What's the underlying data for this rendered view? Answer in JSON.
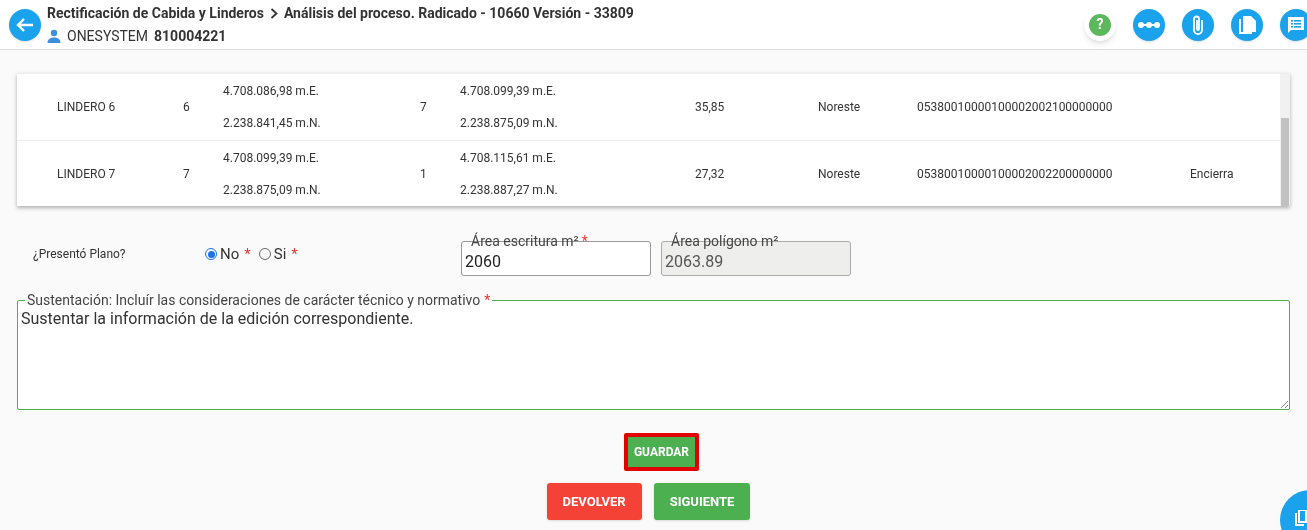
{
  "header": {
    "breadcrumb": [
      "Rectificación de Cabida y Linderos",
      "Análisis del proceso. Radicado - 10660 Versión - 33809"
    ],
    "user_label": "ONESYSTEM",
    "user_id": "810004221",
    "actions": [
      {
        "kind": "help",
        "label": "?"
      },
      {
        "kind": "flow"
      },
      {
        "kind": "attach"
      },
      {
        "kind": "docs"
      },
      {
        "kind": "notes"
      }
    ]
  },
  "table": {
    "rows": [
      {
        "name": "LINDERO 6",
        "from": "6",
        "from_east": "4.708.086,98 m.E.",
        "from_north": "2.238.841,45 m.N.",
        "to": "7",
        "to_east": "4.708.099,39 m.E.",
        "to_north": "2.238.875,09 m.N.",
        "distance": "35,85",
        "direction": "Noreste",
        "code": "05380010000100002002100000000"
      },
      {
        "name": "LINDERO 7",
        "from": "7",
        "from_east": "4.708.099,39 m.E.",
        "from_north": "2.238.875,09 m.N.",
        "to": "1",
        "to_east": "4.708.115,61 m.E.",
        "to_north": "2.238.887,27 m.N.",
        "distance": "27,32",
        "direction": "Noreste",
        "code": "05380010000100002002200000000",
        "note": "Encierra"
      }
    ]
  },
  "plano": {
    "label": "¿Presentó Plano?",
    "options": [
      {
        "label": "No",
        "selected": true,
        "required_mark": "*"
      },
      {
        "label": "Si",
        "selected": false,
        "required_mark": "*"
      }
    ]
  },
  "fields": [
    {
      "label": "Área escritura m²",
      "value": "2060",
      "required_mark": "*",
      "disabled": false
    },
    {
      "label": "Área polígono m²",
      "value": "2063.89",
      "disabled": true
    }
  ],
  "sustentacion": {
    "label": "Sustentación: Incluír las consideraciones de carácter técnico y normativo",
    "required_mark": "*",
    "value": "Sustentar la información de la edición correspondiente."
  },
  "save_button": {
    "label": "GUARDAR",
    "highlighted": true
  },
  "buttons": [
    {
      "kind": "danger",
      "label": "DEVOLVER"
    },
    {
      "kind": "success",
      "label": "SIGUIENTE"
    }
  ]
}
